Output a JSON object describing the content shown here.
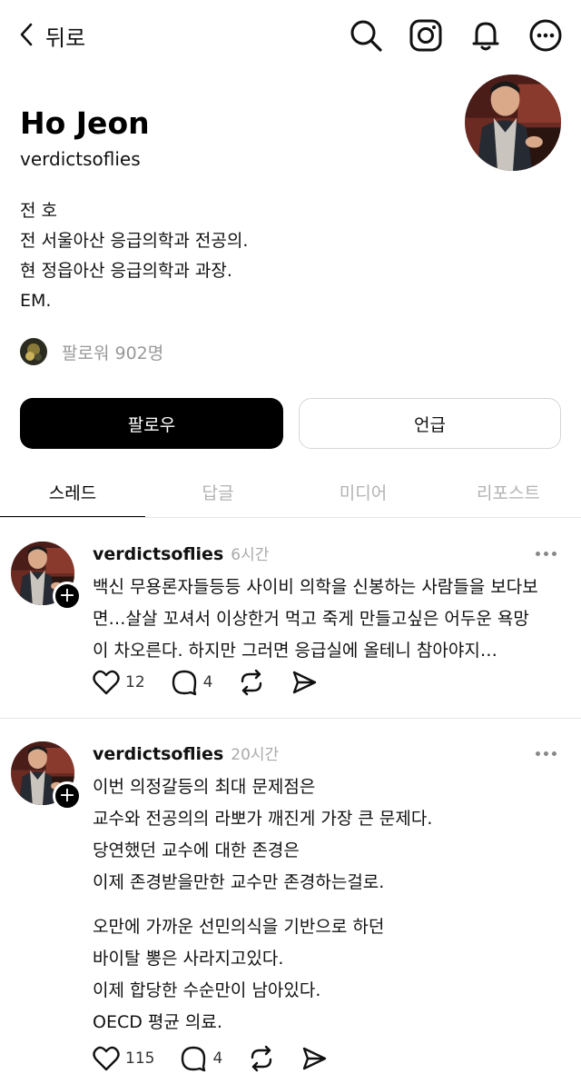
{
  "topbar": {
    "back_label": "뒤로",
    "icons": [
      "search-icon",
      "instagram-icon",
      "bell-icon",
      "more-icon"
    ]
  },
  "profile": {
    "name": "Ho Jeon",
    "handle": "verdictsoflies",
    "bio": [
      "전 호",
      "전 서울아산 응급의학과 전공의.",
      "현 정읍아산 응급의학과 과장.",
      "EM."
    ],
    "followers": "팔로워 902명"
  },
  "buttons": {
    "follow": "팔로우",
    "mention": "언급"
  },
  "tabs": [
    "스레드",
    "답글",
    "미디어",
    "리포스트"
  ],
  "posts": [
    {
      "user": "verdictsoflies",
      "time": "6시간",
      "lines": [
        "백신 무용론자들등등 사이비 의학을 신봉하는 사람들을 보다보",
        "면…살살 꼬셔서 이상한거 먹고 죽게 만들고싶은 어두운 욕망",
        "이 차오른다. 하지만 그러면 응급실에 올테니 참아야지…"
      ],
      "likes": "12",
      "replies": "4"
    },
    {
      "user": "verdictsoflies",
      "time": "20시간",
      "para1": [
        "이번 의정갈등의 최대 문제점은",
        "교수와 전공의의 라뽀가 깨진게 가장 큰 문제다.",
        "당연했던 교수에 대한 존경은",
        "이제 존경받을만한 교수만 존경하는걸로."
      ],
      "para2": [
        "오만에 가까운 선민의식을 기반으로 하던",
        "바이탈 뽕은 사라지고있다.",
        "이제 합당한 수순만이 남아있다.",
        "OECD 평균 의료."
      ],
      "likes": "115",
      "replies": "4"
    }
  ]
}
